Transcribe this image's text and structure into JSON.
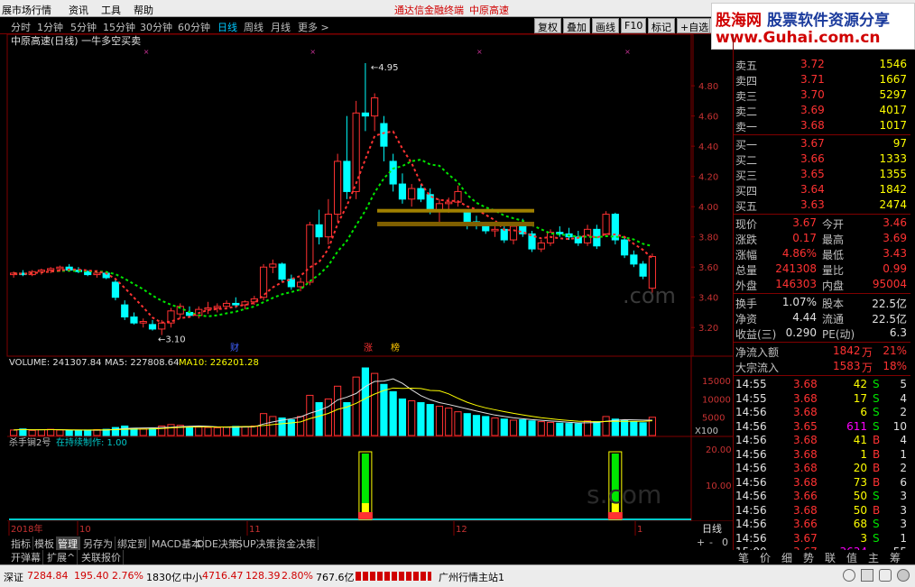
{
  "menu": {
    "items": [
      "展市场行情",
      "资讯",
      "工具",
      "帮助"
    ],
    "center_title": "通达信金融终端",
    "stock_title": "中原高速"
  },
  "periods": [
    "分时",
    "1分钟",
    "5分钟",
    "15分钟",
    "30分钟",
    "60分钟",
    "日线",
    "周线",
    "月线",
    "更多 >"
  ],
  "active_period": "日线",
  "toolbar_buttons": [
    "复权",
    "叠加",
    "画线",
    "F10",
    "标记",
    "+自选",
    "返回"
  ],
  "watermark": {
    "brand": "股海网",
    "slogan": "股票软件资源分享",
    "url": "www.Guhai.com.cn"
  },
  "main_chart": {
    "title": "中原高速(日线) 一牛多空买卖",
    "high_label": "4.95",
    "low_label": "3.10",
    "y_ticks": [
      "4.80",
      "4.60",
      "4.40",
      "4.20",
      "4.00",
      "3.80",
      "3.60",
      "3.40",
      "3.20"
    ],
    "markers": [
      {
        "text": "财"
      },
      {
        "text": "涨"
      },
      {
        "text": "榜"
      }
    ],
    "watermark_text": ".com"
  },
  "chart_data": {
    "type": "candlestick",
    "ylim": [
      3.1,
      4.95
    ],
    "candles": [
      [
        3.55,
        3.57,
        3.53,
        3.56
      ],
      [
        3.56,
        3.58,
        3.54,
        3.55
      ],
      [
        3.55,
        3.58,
        3.54,
        3.57
      ],
      [
        3.57,
        3.59,
        3.55,
        3.58
      ],
      [
        3.58,
        3.6,
        3.56,
        3.59
      ],
      [
        3.59,
        3.61,
        3.57,
        3.6
      ],
      [
        3.6,
        3.62,
        3.57,
        3.58
      ],
      [
        3.58,
        3.6,
        3.56,
        3.57
      ],
      [
        3.57,
        3.58,
        3.54,
        3.55
      ],
      [
        3.55,
        3.58,
        3.53,
        3.56
      ],
      [
        3.56,
        3.57,
        3.52,
        3.53
      ],
      [
        3.5,
        3.52,
        3.38,
        3.4
      ],
      [
        3.35,
        3.38,
        3.25,
        3.27
      ],
      [
        3.27,
        3.3,
        3.22,
        3.23
      ],
      [
        3.23,
        3.26,
        3.2,
        3.24
      ],
      [
        3.22,
        3.25,
        3.18,
        3.19
      ],
      [
        3.19,
        3.25,
        3.15,
        3.23
      ],
      [
        3.23,
        3.33,
        3.2,
        3.31
      ],
      [
        3.29,
        3.36,
        3.26,
        3.34
      ],
      [
        3.3,
        3.34,
        3.27,
        3.28
      ],
      [
        3.28,
        3.34,
        3.26,
        3.32
      ],
      [
        3.32,
        3.37,
        3.29,
        3.33
      ],
      [
        3.33,
        3.36,
        3.3,
        3.34
      ],
      [
        3.34,
        3.38,
        3.32,
        3.36
      ],
      [
        3.36,
        3.4,
        3.33,
        3.35
      ],
      [
        3.35,
        3.38,
        3.32,
        3.37
      ],
      [
        3.37,
        3.41,
        3.35,
        3.39
      ],
      [
        3.4,
        3.62,
        3.38,
        3.6
      ],
      [
        3.6,
        3.65,
        3.56,
        3.62
      ],
      [
        3.62,
        3.63,
        3.5,
        3.52
      ],
      [
        3.52,
        3.55,
        3.45,
        3.47
      ],
      [
        3.47,
        3.53,
        3.44,
        3.5
      ],
      [
        3.5,
        3.9,
        3.48,
        3.88
      ],
      [
        3.88,
        3.98,
        3.75,
        3.8
      ],
      [
        3.8,
        4.05,
        3.75,
        3.95
      ],
      [
        3.95,
        4.35,
        3.9,
        4.3
      ],
      [
        4.3,
        4.6,
        4.05,
        4.1
      ],
      [
        4.1,
        4.7,
        4.05,
        4.62
      ],
      [
        4.62,
        4.95,
        4.5,
        4.6
      ],
      [
        4.6,
        4.75,
        4.5,
        4.72
      ],
      [
        4.55,
        4.6,
        4.3,
        4.4
      ],
      [
        4.3,
        4.35,
        4.1,
        4.15
      ],
      [
        4.15,
        4.22,
        4.02,
        4.05
      ],
      [
        4.05,
        4.15,
        4.0,
        4.12
      ],
      [
        4.12,
        4.15,
        4.03,
        4.05
      ],
      [
        4.08,
        4.12,
        3.95,
        3.98
      ],
      [
        3.98,
        4.05,
        3.88,
        4.02
      ],
      [
        4.02,
        4.06,
        3.96,
        4.03
      ],
      [
        4.03,
        4.14,
        4.0,
        4.1
      ],
      [
        3.96,
        3.98,
        3.85,
        3.88
      ],
      [
        3.9,
        3.94,
        3.85,
        3.88
      ],
      [
        3.88,
        3.9,
        3.82,
        3.84
      ],
      [
        3.84,
        3.88,
        3.8,
        3.85
      ],
      [
        3.85,
        3.89,
        3.76,
        3.78
      ],
      [
        3.78,
        3.9,
        3.75,
        3.87
      ],
      [
        3.87,
        3.92,
        3.8,
        3.82
      ],
      [
        3.82,
        3.84,
        3.7,
        3.72
      ],
      [
        3.72,
        3.78,
        3.7,
        3.76
      ],
      [
        3.76,
        3.85,
        3.74,
        3.83
      ],
      [
        3.83,
        3.87,
        3.8,
        3.82
      ],
      [
        3.82,
        3.86,
        3.78,
        3.8
      ],
      [
        3.8,
        3.84,
        3.74,
        3.76
      ],
      [
        3.76,
        3.88,
        3.74,
        3.85
      ],
      [
        3.85,
        3.88,
        3.72,
        3.74
      ],
      [
        3.82,
        3.97,
        3.8,
        3.95
      ],
      [
        3.95,
        3.96,
        3.75,
        3.78
      ],
      [
        3.78,
        3.8,
        3.66,
        3.68
      ],
      [
        3.68,
        3.71,
        3.6,
        3.62
      ],
      [
        3.62,
        3.64,
        3.52,
        3.54
      ],
      [
        3.46,
        3.69,
        3.43,
        3.67
      ]
    ],
    "volume": {
      "title": "VOLUME:",
      "title_value": "241307.84",
      "ma5_label": "MA5:",
      "ma5": "227808.64",
      "ma10_label": "MA10:",
      "ma10": "226201.28",
      "y_ticks": [
        "15000",
        "10000",
        "5000"
      ],
      "unit": "X100",
      "values": [
        150,
        180,
        140,
        160,
        170,
        150,
        140,
        130,
        150,
        160,
        170,
        220,
        260,
        200,
        180,
        190,
        260,
        300,
        280,
        240,
        230,
        220,
        210,
        230,
        250,
        240,
        260,
        600,
        520,
        480,
        430,
        520,
        1100,
        900,
        1000,
        1350,
        900,
        1600,
        1850,
        1700,
        1400,
        1200,
        1000,
        950,
        900,
        850,
        800,
        750,
        650,
        600,
        550,
        520,
        480,
        450,
        420,
        430,
        400,
        380,
        360,
        340,
        330,
        320,
        400,
        380,
        520,
        450,
        420,
        380,
        350,
        500
      ]
    },
    "indicator": {
      "title": "杀手锏2号",
      "subtitle": "在持续制作:",
      "value": "1.00",
      "y_ticks": [
        "20.00",
        "10.00"
      ],
      "signal_bars": [
        38,
        65,
        70
      ]
    }
  },
  "date_axis": [
    "2018年",
    "10",
    "11",
    "12",
    "1"
  ],
  "period_label": "日线",
  "quote_panel": {
    "asks": [
      {
        "label": "卖五",
        "price": "3.72",
        "vol": "1546"
      },
      {
        "label": "卖四",
        "price": "3.71",
        "vol": "1667"
      },
      {
        "label": "卖三",
        "price": "3.70",
        "vol": "5297"
      },
      {
        "label": "卖二",
        "price": "3.69",
        "vol": "4017"
      },
      {
        "label": "卖一",
        "price": "3.68",
        "vol": "1017"
      }
    ],
    "bids": [
      {
        "label": "买一",
        "price": "3.67",
        "vol": "97"
      },
      {
        "label": "买二",
        "price": "3.66",
        "vol": "1333"
      },
      {
        "label": "买三",
        "price": "3.65",
        "vol": "1355"
      },
      {
        "label": "买四",
        "price": "3.64",
        "vol": "1842"
      },
      {
        "label": "买五",
        "price": "3.63",
        "vol": "2474"
      }
    ],
    "stats": [
      {
        "l1": "现价",
        "v1": "3.67",
        "l2": "今开",
        "v2": "3.46"
      },
      {
        "l1": "涨跌",
        "v1": "0.17",
        "l2": "最高",
        "v2": "3.69"
      },
      {
        "l1": "涨幅",
        "v1": "4.86%",
        "l2": "最低",
        "v2": "3.43"
      },
      {
        "l1": "总量",
        "v1": "241308",
        "l2": "量比",
        "v2": "0.99"
      },
      {
        "l1": "外盘",
        "v1": "146303",
        "l2": "内盘",
        "v2": "95004"
      }
    ],
    "stats2": [
      {
        "l1": "换手",
        "v1": "1.07%",
        "l2": "股本",
        "v2": "22.5亿"
      },
      {
        "l1": "净资",
        "v1": "4.44",
        "l2": "流通",
        "v2": "22.5亿"
      },
      {
        "l1": "收益(三)",
        "v1": "0.290",
        "l2": "PE(动)",
        "v2": "6.3"
      }
    ],
    "flows": [
      {
        "label": "净流入额",
        "value": "1842",
        "unit": "万",
        "pct": "21%"
      },
      {
        "label": "大宗流入",
        "value": "1583",
        "unit": "万",
        "pct": "18%"
      }
    ],
    "ticks": [
      {
        "time": "14:55",
        "price": "3.68",
        "vol": "42",
        "side": "S",
        "n": "5"
      },
      {
        "time": "14:55",
        "price": "3.68",
        "vol": "17",
        "side": "S",
        "n": "4"
      },
      {
        "time": "14:56",
        "price": "3.68",
        "vol": "6",
        "side": "S",
        "n": "2"
      },
      {
        "time": "14:56",
        "price": "3.65",
        "vol": "611",
        "side": "S",
        "n": "10"
      },
      {
        "time": "14:56",
        "price": "3.68",
        "vol": "41",
        "side": "B",
        "n": "4"
      },
      {
        "time": "14:56",
        "price": "3.68",
        "vol": "1",
        "side": "B",
        "n": "1"
      },
      {
        "time": "14:56",
        "price": "3.68",
        "vol": "20",
        "side": "B",
        "n": "2"
      },
      {
        "time": "14:56",
        "price": "3.68",
        "vol": "73",
        "side": "B",
        "n": "6"
      },
      {
        "time": "14:56",
        "price": "3.66",
        "vol": "50",
        "side": "S",
        "n": "3"
      },
      {
        "time": "14:56",
        "price": "3.68",
        "vol": "50",
        "side": "B",
        "n": "3"
      },
      {
        "time": "14:56",
        "price": "3.66",
        "vol": "68",
        "side": "S",
        "n": "3"
      },
      {
        "time": "14:56",
        "price": "3.67",
        "vol": "3",
        "side": "S",
        "n": "1"
      },
      {
        "time": "15:00",
        "price": "3.67",
        "vol": "3634",
        "side": "",
        "n": "55"
      }
    ]
  },
  "bottom_tabs": [
    "指标",
    "模板",
    "管理",
    "另存为",
    "绑定到",
    "MACD基本",
    "DDE决策",
    "SUP决策",
    "资金决策"
  ],
  "bottom_tabs2": [
    "开弹幕",
    "扩展^",
    "关联报价"
  ],
  "zoom_buttons": [
    "+",
    "-",
    "0"
  ],
  "panel_tabs": [
    "笔",
    "价",
    "细",
    "势",
    "联",
    "值",
    "主",
    "筹"
  ],
  "status": {
    "sz_label": "深证",
    "sz_value": "7284.84",
    "sz_change": "195.40",
    "sz_pct": "2.76%",
    "sz_amount": "1830亿",
    "zx_label": "中小",
    "zx_value": "4716.47",
    "zx_change": "128.39",
    "zx_pct": "2.80%",
    "zx_amount": "767.6亿",
    "server": "广州行情主站1"
  },
  "colors": {
    "up": "#ff3232",
    "down": "#00ffff",
    "ma_green": "#00e600",
    "ma_red": "#ff3232",
    "yellow": "#ffff00",
    "grid": "#800000"
  }
}
